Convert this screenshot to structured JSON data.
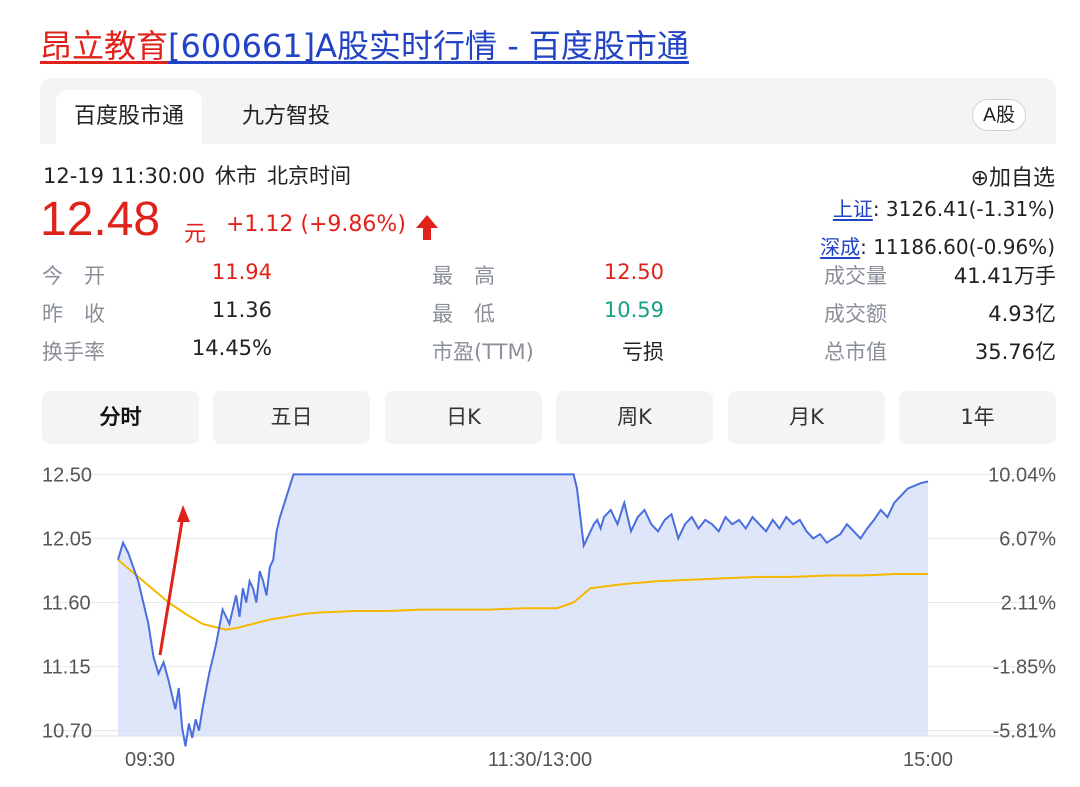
{
  "page_title": {
    "name": "昂立教育",
    "rest": "[600661]A股实时行情 - 百度股市通"
  },
  "tabs": [
    {
      "label": "百度股市通",
      "active": true
    },
    {
      "label": "九方智投",
      "active": false
    }
  ],
  "market_badge": "A股",
  "status": {
    "datetime": "12-19 11:30:00",
    "state": "休市",
    "timezone": "北京时间"
  },
  "quote": {
    "price": "12.48",
    "unit": "元",
    "change": "+1.12 (+9.86%)",
    "direction": "up"
  },
  "watchlist_label": "⊕加自选",
  "indices": [
    {
      "name": "上证",
      "value": ": 3126.41(-1.31%)"
    },
    {
      "name": "深成",
      "value": ": 11186.60(-0.96%)"
    }
  ],
  "stats": {
    "open": {
      "label": "今　开",
      "value": "11.94"
    },
    "prev_close": {
      "label": "昨　收",
      "value": "11.36"
    },
    "turnover_rate": {
      "label": "换手率",
      "value": "14.45%"
    },
    "high": {
      "label": "最　高",
      "value": "12.50"
    },
    "low": {
      "label": "最　低",
      "value": "10.59"
    },
    "pe": {
      "label": "市盈(TTM)",
      "value": "亏损"
    },
    "volume": {
      "label": "成交量",
      "value": "41.41万手"
    },
    "amount": {
      "label": "成交额",
      "value": "4.93亿"
    },
    "market_cap": {
      "label": "总市值",
      "value": "35.76亿"
    }
  },
  "periods": [
    {
      "label": "分时",
      "active": true
    },
    {
      "label": "五日",
      "active": false
    },
    {
      "label": "日K",
      "active": false
    },
    {
      "label": "周K",
      "active": false
    },
    {
      "label": "月K",
      "active": false
    },
    {
      "label": "1年",
      "active": false
    }
  ],
  "colors": {
    "up": "#e0221b",
    "down": "#16a085",
    "price_line": "#4a6ee0",
    "avg_line": "#f5b700",
    "area_fill": "#d6ddf8"
  },
  "chart_data": {
    "type": "line",
    "y_ticks_left": [
      "12.50",
      "12.05",
      "11.60",
      "11.15",
      "10.70"
    ],
    "y_ticks_right": [
      "10.04%",
      "6.07%",
      "2.11%",
      "-1.85%",
      "-5.81%"
    ],
    "x_ticks": [
      "09:30",
      "11:30/13:00",
      "15:00"
    ],
    "ylim": [
      10.55,
      12.65
    ],
    "xlim": [
      0,
      240
    ],
    "series": [
      {
        "key": "price",
        "x": [
          0,
          1.5,
          3,
          4.5,
          6,
          7.5,
          9,
          10.5,
          12,
          13.5,
          15,
          16,
          17,
          18,
          19,
          20,
          21,
          22,
          23,
          24,
          25,
          27,
          29,
          31,
          33,
          35,
          36,
          37,
          38,
          39,
          40,
          41,
          42,
          43,
          44,
          45,
          46,
          47,
          48,
          50,
          52,
          55,
          60,
          70,
          80,
          90,
          100,
          110,
          120,
          128,
          132,
          135,
          136,
          137,
          138,
          139,
          140,
          141,
          142,
          143,
          144,
          146,
          148,
          150,
          152,
          154,
          156,
          158,
          160,
          162,
          164,
          166,
          168,
          170,
          172,
          174,
          176,
          178,
          180,
          182,
          184,
          186,
          188,
          190,
          192,
          194,
          196,
          198,
          200,
          202,
          204,
          206,
          208,
          210,
          212,
          214,
          216,
          218,
          220,
          222,
          224,
          226,
          228,
          230,
          232,
          234,
          236,
          238,
          240
        ],
        "values": [
          11.9,
          12.02,
          11.95,
          11.85,
          11.75,
          11.6,
          11.45,
          11.22,
          11.1,
          11.18,
          11.05,
          10.95,
          10.85,
          11.0,
          10.72,
          10.59,
          10.75,
          10.65,
          10.78,
          10.7,
          10.85,
          11.1,
          11.3,
          11.55,
          11.45,
          11.65,
          11.5,
          11.7,
          11.6,
          11.75,
          11.7,
          11.6,
          11.82,
          11.75,
          11.65,
          11.85,
          11.9,
          12.1,
          12.2,
          12.35,
          12.5,
          12.5,
          12.5,
          12.5,
          12.5,
          12.5,
          12.5,
          12.5,
          12.5,
          12.5,
          12.5,
          12.5,
          12.4,
          12.2,
          12.0,
          12.05,
          12.1,
          12.15,
          12.18,
          12.12,
          12.2,
          12.25,
          12.15,
          12.3,
          12.1,
          12.2,
          12.25,
          12.15,
          12.1,
          12.18,
          12.22,
          12.05,
          12.15,
          12.2,
          12.12,
          12.18,
          12.15,
          12.1,
          12.2,
          12.15,
          12.18,
          12.12,
          12.2,
          12.15,
          12.1,
          12.18,
          12.12,
          12.2,
          12.15,
          12.18,
          12.1,
          12.05,
          12.08,
          12.02,
          12.05,
          12.08,
          12.15,
          12.1,
          12.05,
          12.12,
          12.18,
          12.25,
          12.2,
          12.3,
          12.35,
          12.4,
          12.42,
          12.44,
          12.45
        ]
      },
      {
        "key": "average",
        "x": [
          0,
          5,
          10,
          15,
          20,
          25,
          30,
          32,
          35,
          40,
          45,
          50,
          55,
          60,
          70,
          80,
          90,
          100,
          110,
          120,
          125,
          130,
          135,
          140,
          150,
          160,
          170,
          180,
          190,
          200,
          210,
          220,
          230,
          240
        ],
        "values": [
          11.9,
          11.8,
          11.7,
          11.6,
          11.52,
          11.45,
          11.42,
          11.41,
          11.42,
          11.45,
          11.48,
          11.5,
          11.52,
          11.53,
          11.54,
          11.54,
          11.55,
          11.55,
          11.55,
          11.56,
          11.56,
          11.56,
          11.6,
          11.7,
          11.73,
          11.75,
          11.76,
          11.77,
          11.78,
          11.78,
          11.79,
          11.79,
          11.8,
          11.8
        ]
      }
    ],
    "grid": true
  }
}
